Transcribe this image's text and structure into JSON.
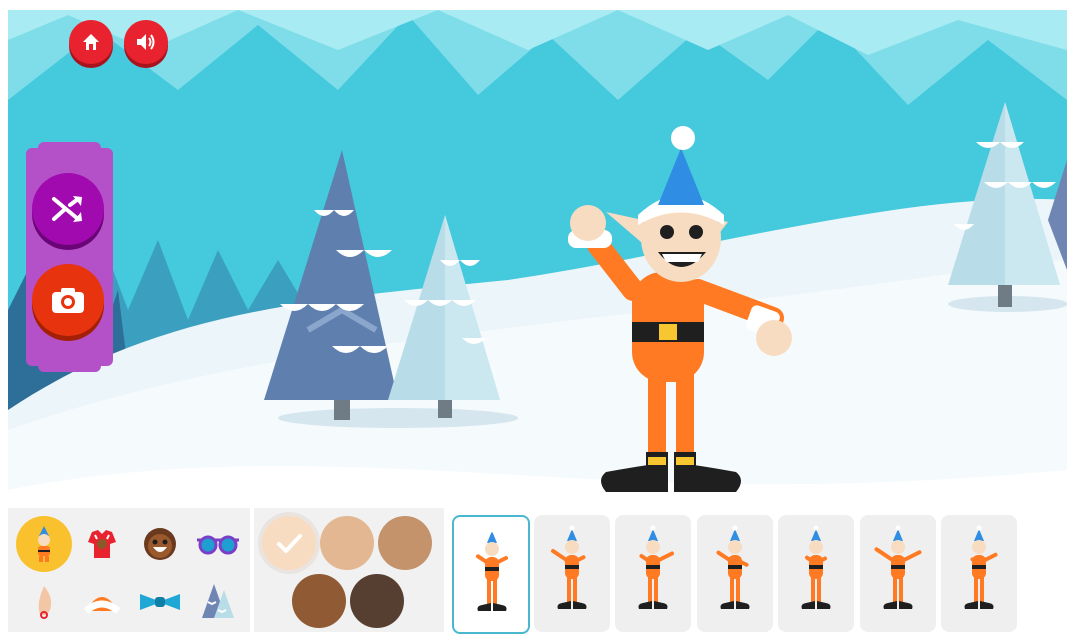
{
  "top_buttons": {
    "home_icon": "home-icon",
    "sound_icon": "speaker-icon"
  },
  "side_tools": {
    "shuffle_icon": "shuffle-icon",
    "camera_icon": "camera-icon"
  },
  "categories": [
    {
      "name": "elf",
      "icon": "elf-icon",
      "selected": true
    },
    {
      "name": "shirt",
      "icon": "sweater-icon",
      "selected": false
    },
    {
      "name": "face",
      "icon": "face-icon",
      "selected": false
    },
    {
      "name": "glasses",
      "icon": "glasses-icon",
      "selected": false
    },
    {
      "name": "ears",
      "icon": "ear-icon",
      "selected": false
    },
    {
      "name": "hat",
      "icon": "hat-icon",
      "selected": false
    },
    {
      "name": "bow",
      "icon": "bow-tie-icon",
      "selected": false
    },
    {
      "name": "background",
      "icon": "tree-icon",
      "selected": false
    }
  ],
  "colors": {
    "accent": "#49b8cf",
    "skin_swatches": [
      "#f7dcc1",
      "#e2b791",
      "#c4936b",
      "#8f5a34",
      "#563f31"
    ],
    "selected_swatch": 0,
    "elf_suit": "#ff7a22",
    "hat": "#2f8de4"
  },
  "poses": {
    "count": 7,
    "selected": 0
  }
}
